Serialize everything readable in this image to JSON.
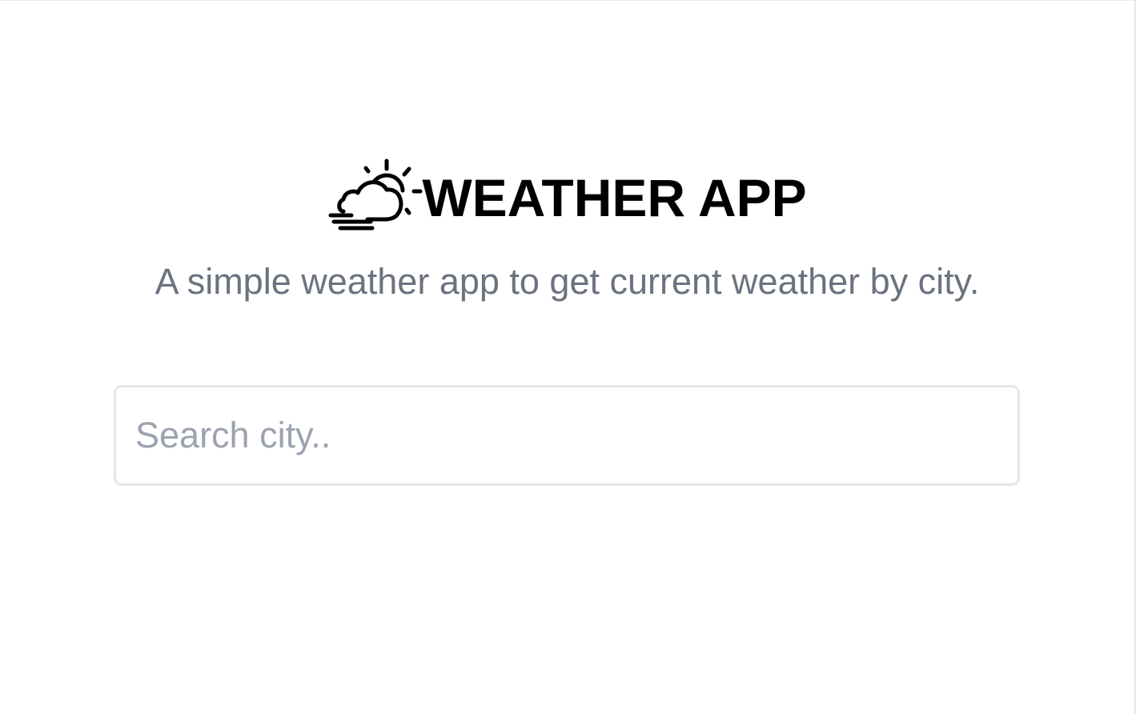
{
  "app": {
    "title": "WEATHER APP",
    "logo_icon": "cloud-sun-wind-icon",
    "subtitle": "A simple weather app to get current weather by city."
  },
  "search": {
    "placeholder": "Search city..",
    "value": ""
  },
  "colors": {
    "title": "#000000",
    "subtitle": "#6b7280",
    "placeholder": "#9ca3af",
    "input_border": "#e5e7eb",
    "background": "#ffffff"
  }
}
